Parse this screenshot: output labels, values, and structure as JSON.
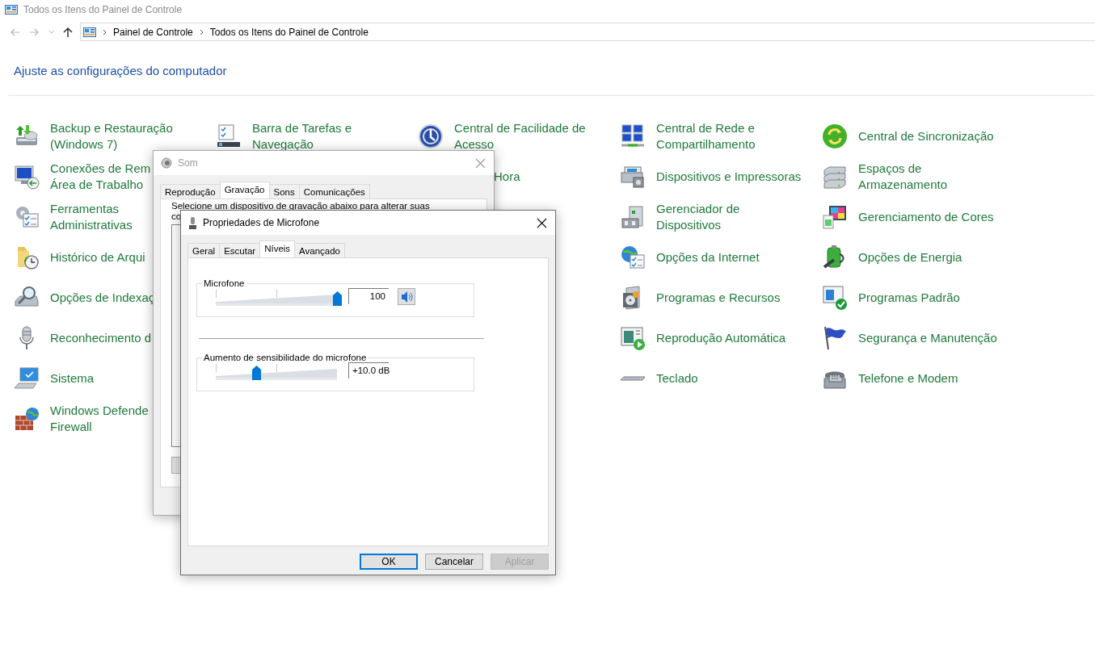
{
  "window": {
    "title": "Todos os Itens do Painel de Controle"
  },
  "address_bar": {
    "breadcrumbs": [
      "Painel de Controle",
      "Todos os Itens do Painel de Controle"
    ]
  },
  "heading": "Ajuste as configurações do computador",
  "columns": [
    {
      "items": [
        {
          "kind": "full",
          "lines": [
            "Backup e Restauração",
            "(Windows 7)"
          ]
        },
        {
          "kind": "full",
          "lines": [
            "Conexões de Rem",
            "Área de Trabalho"
          ]
        },
        {
          "kind": "full",
          "lines": [
            "Ferramentas",
            "Administrativas"
          ]
        },
        {
          "kind": "full",
          "lines": [
            "Histórico de Arqui"
          ]
        },
        {
          "kind": "full",
          "lines": [
            "Opções de Indexaç"
          ]
        },
        {
          "kind": "full",
          "lines": [
            "Reconhecimento d"
          ]
        },
        {
          "kind": "full",
          "lines": [
            "Sistema"
          ]
        },
        {
          "kind": "full",
          "lines": [
            "Windows Defende",
            "Firewall"
          ]
        }
      ]
    },
    {
      "items": [
        {
          "kind": "full",
          "lines": [
            "Barra de Tarefas e",
            "Navegação"
          ]
        }
      ]
    },
    {
      "items": [
        {
          "kind": "full",
          "lines": [
            "Central de Facilidade de",
            "Acesso"
          ]
        },
        {
          "kind": "cut",
          "lines": [
            "Hora"
          ]
        }
      ]
    },
    {
      "items": [
        {
          "kind": "full",
          "lines": [
            "Central de Rede e",
            "Compartilhamento"
          ]
        },
        {
          "kind": "full",
          "lines": [
            "Dispositivos e Impressoras"
          ]
        },
        {
          "kind": "full",
          "lines": [
            "Gerenciador de",
            "Dispositivos"
          ]
        },
        {
          "kind": "full",
          "lines": [
            "Opções da Internet"
          ]
        },
        {
          "kind": "full",
          "lines": [
            "Programas e Recursos"
          ]
        },
        {
          "kind": "full",
          "lines": [
            "Reprodução Automática"
          ]
        },
        {
          "kind": "full",
          "lines": [
            "Teclado"
          ]
        }
      ]
    },
    {
      "items": [
        {
          "kind": "full",
          "lines": [
            "Central de Sincronização"
          ]
        },
        {
          "kind": "full",
          "lines": [
            "Espaços de",
            "Armazenamento"
          ]
        },
        {
          "kind": "full",
          "lines": [
            "Gerenciamento de Cores"
          ]
        },
        {
          "kind": "full",
          "lines": [
            "Opções de Energia"
          ]
        },
        {
          "kind": "full",
          "lines": [
            "Programas Padrão"
          ]
        },
        {
          "kind": "full",
          "lines": [
            "Segurança e Manutenção"
          ]
        },
        {
          "kind": "full",
          "lines": [
            "Telefone e Modem"
          ]
        }
      ]
    }
  ],
  "sound_dialog": {
    "title": "Som",
    "tabs": [
      {
        "label": "Reprodução",
        "selected": false
      },
      {
        "label": "Gravação",
        "selected": true
      },
      {
        "label": "Sons",
        "selected": false
      },
      {
        "label": "Comunicações",
        "selected": false
      }
    ],
    "instruction_lines": [
      "Selecione um dispositivo de gravação abaixo para alterar suas",
      "co"
    ]
  },
  "mic_dialog": {
    "title": "Propriedades de Microfone",
    "tabs": [
      {
        "label": "Geral",
        "selected": false
      },
      {
        "label": "Escutar",
        "selected": false
      },
      {
        "label": "Níveis",
        "selected": true
      },
      {
        "label": "Avançado",
        "selected": false
      }
    ],
    "levels": [
      {
        "kind": "volume",
        "label": "Microfone",
        "level": 1.0,
        "reading": "100",
        "muted": false
      },
      {
        "kind": "boost",
        "label": "Aumento de sensibilidade do microfone",
        "level": 0.33,
        "reading": "+10.0 dB"
      }
    ],
    "buttons": [
      {
        "label": "OK",
        "default": true,
        "disabled": false
      },
      {
        "label": "Cancelar",
        "default": false,
        "disabled": false
      },
      {
        "label": "Aplicar",
        "default": false,
        "disabled": true
      }
    ]
  }
}
